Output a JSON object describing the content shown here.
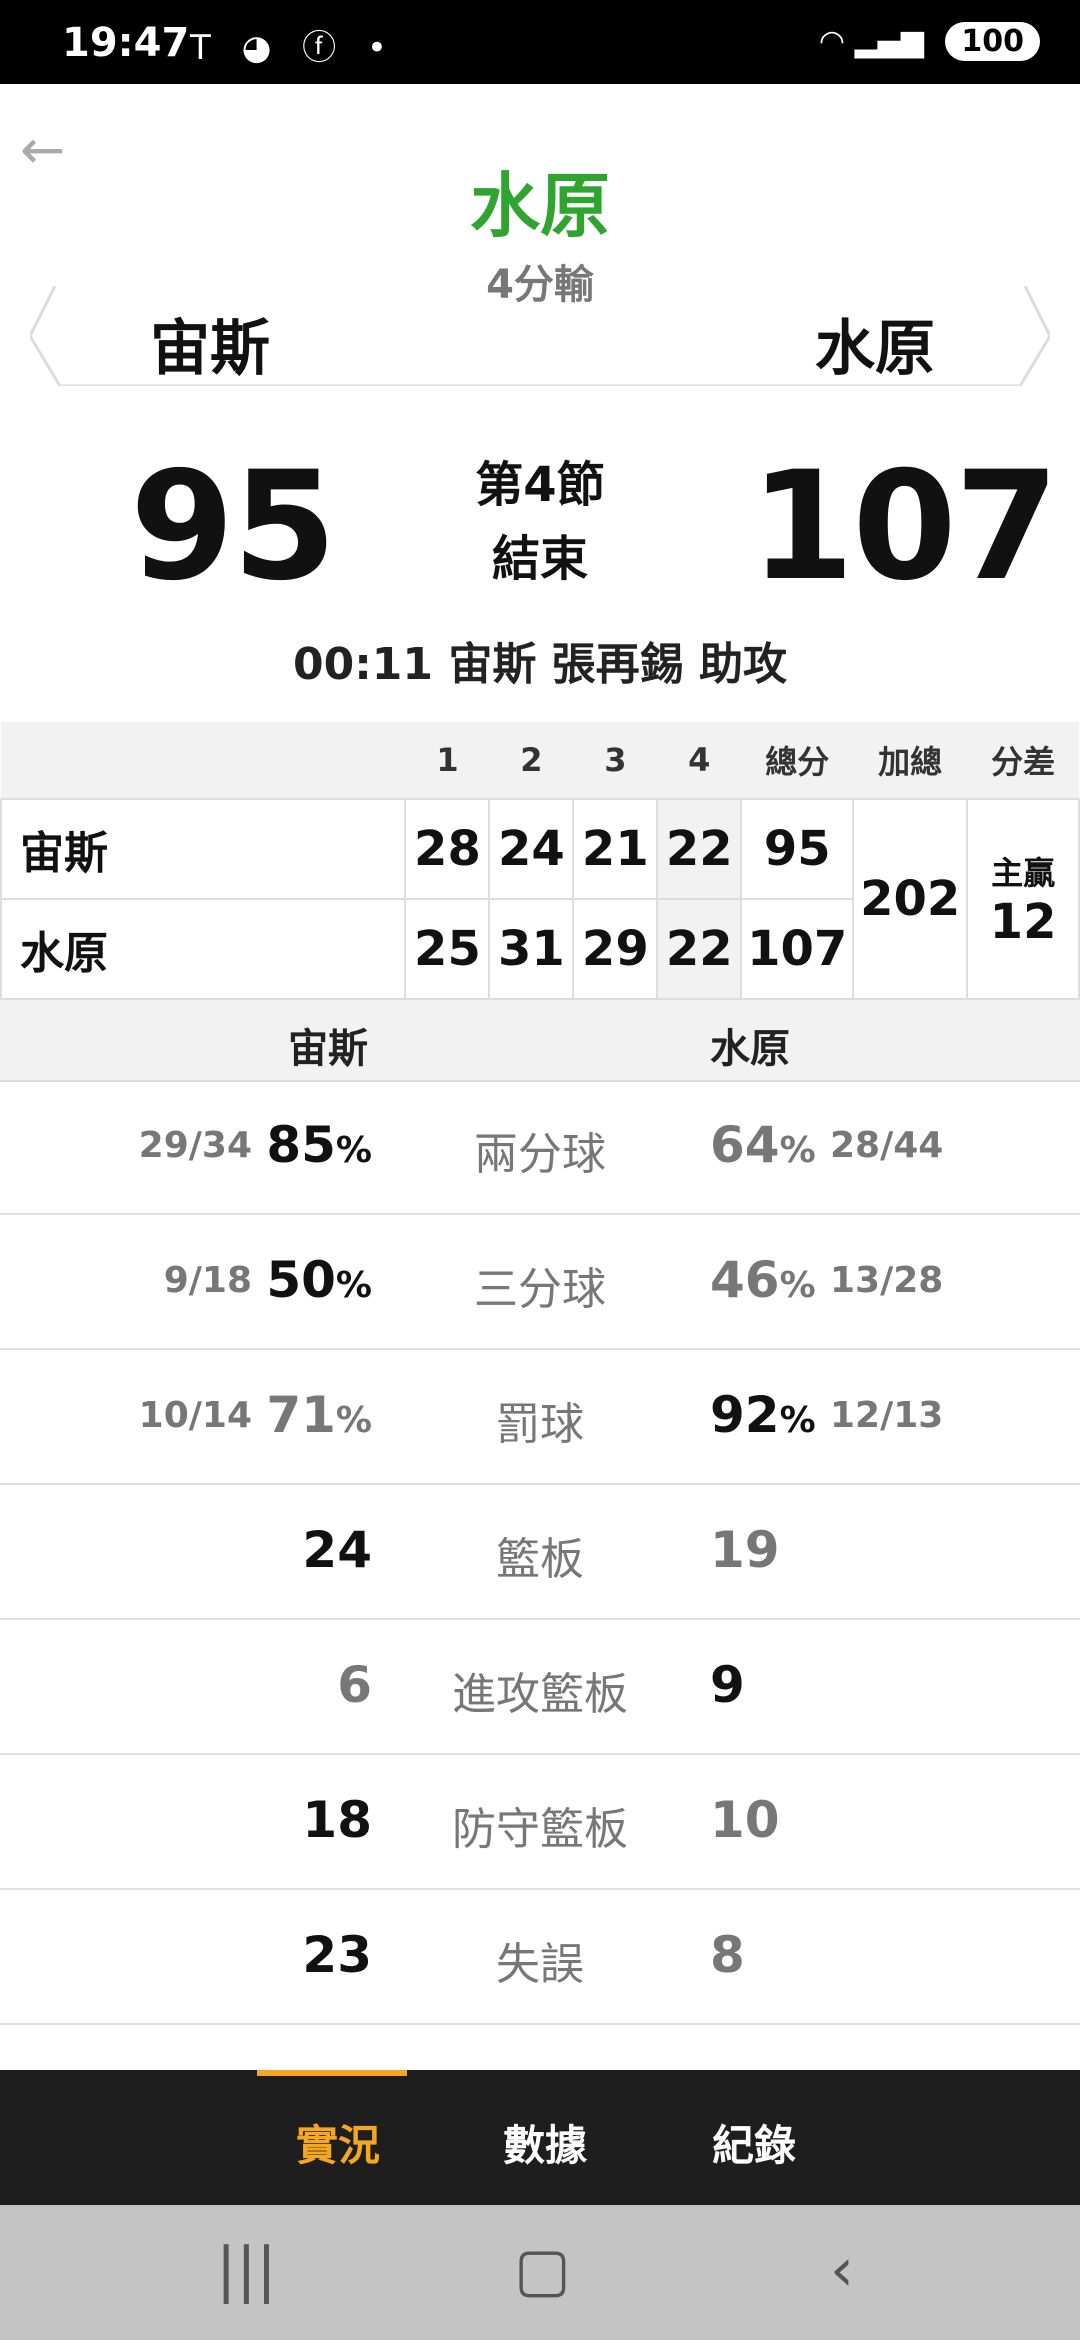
{
  "status_bar": {
    "time": "19:47",
    "battery": "100",
    "left_icons": [
      "tesla-icon",
      "gamepad-icon",
      "facebook-icon",
      "dot-icon"
    ],
    "right_icons": [
      "wifi-icon",
      "signal-icon"
    ]
  },
  "header": {
    "title": "水原",
    "result": "4分輸",
    "team_left": "宙斯",
    "team_right": "水原",
    "title_color": "#2fa52f"
  },
  "scoreboard": {
    "score_left": "95",
    "score_right": "107",
    "period_line1": "第4節",
    "period_line2": "結束",
    "last_play": "00:11 宙斯 張再錫 助攻"
  },
  "box_score": {
    "headers": [
      "1",
      "2",
      "3",
      "4",
      "總分",
      "加總",
      "分差"
    ],
    "rows": [
      {
        "team": "宙斯",
        "q": [
          "28",
          "24",
          "21",
          "22"
        ],
        "total": "95"
      },
      {
        "team": "水原",
        "q": [
          "25",
          "31",
          "29",
          "22"
        ],
        "total": "107"
      }
    ],
    "combined": "202",
    "diff_label": "主贏",
    "diff_value": "12"
  },
  "stats": {
    "team_left": "宙斯",
    "team_right": "水原",
    "rows": [
      {
        "name": "兩分球",
        "left_frac": "29/34",
        "left_val": "85",
        "left_unit": "%",
        "right_val": "64",
        "right_unit": "%",
        "right_frac": "28/44"
      },
      {
        "name": "三分球",
        "left_frac": "9/18",
        "left_val": "50",
        "left_unit": "%",
        "right_val": "46",
        "right_unit": "%",
        "right_frac": "13/28"
      },
      {
        "name": "罰球",
        "left_frac": "10/14",
        "left_val": "71",
        "left_unit": "%",
        "right_val": "92",
        "right_unit": "%",
        "right_frac": "12/13"
      },
      {
        "name": "籃板",
        "left_frac": "",
        "left_val": "24",
        "left_unit": "",
        "right_val": "19",
        "right_unit": "",
        "right_frac": ""
      },
      {
        "name": "進攻籃板",
        "left_frac": "",
        "left_val": "6",
        "left_unit": "",
        "right_val": "9",
        "right_unit": "",
        "right_frac": ""
      },
      {
        "name": "防守籃板",
        "left_frac": "",
        "left_val": "18",
        "left_unit": "",
        "right_val": "10",
        "right_unit": "",
        "right_frac": ""
      },
      {
        "name": "失誤",
        "left_frac": "",
        "left_val": "23",
        "left_unit": "",
        "right_val": "8",
        "right_unit": "",
        "right_frac": ""
      }
    ]
  },
  "tabs": [
    "實況",
    "數據",
    "紀錄"
  ],
  "active_tab": "實況",
  "accent_color": "#f5a623"
}
